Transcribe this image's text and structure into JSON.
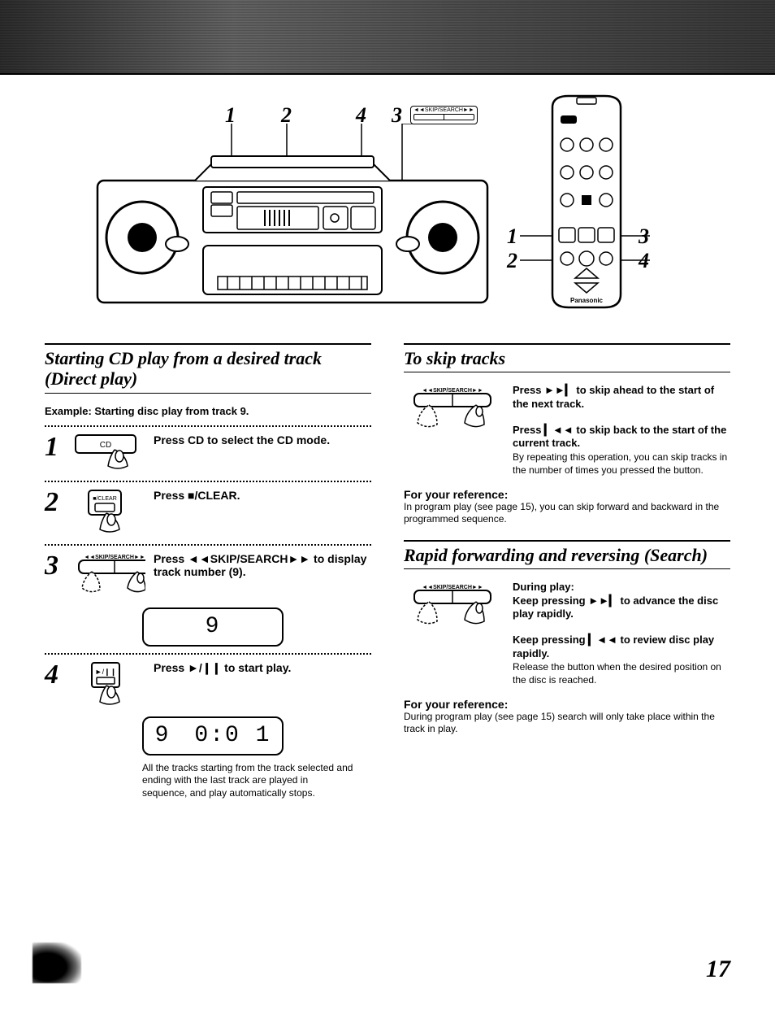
{
  "diagram": {
    "skip_search_label": "◄◄SKIP/SEARCH►►",
    "callouts_boombox": [
      "1",
      "2",
      "4",
      "3"
    ],
    "callouts_remote_left": [
      "1",
      "2"
    ],
    "callouts_remote_right": [
      "3",
      "4"
    ],
    "remote_brand": "Panasonic"
  },
  "left": {
    "title": "Starting CD play from a desired track (Direct play)",
    "example": "Example: Starting disc play from track 9.",
    "steps": [
      {
        "num": "1",
        "icon_label": "CD",
        "text_pre": "Press ",
        "text_b": "CD",
        "text_post": " to select the CD mode."
      },
      {
        "num": "2",
        "icon_label": "■/CLEAR",
        "text_pre": "Press ",
        "text_b": "■/CLEAR",
        "text_post": "."
      },
      {
        "num": "3",
        "icon_label": "◄◄SKIP/SEARCH►►",
        "text_pre": "Press ",
        "text_b": "◄◄SKIP/SEARCH►►",
        "text_post": " to display track number (9).",
        "lcd": {
          "track": "9"
        }
      },
      {
        "num": "4",
        "icon_label": "►/❙❙",
        "text_pre": "Press ",
        "text_b": "►/❙❙",
        "text_post": " to start play.",
        "lcd": {
          "track": "9",
          "time": "0:0 1"
        },
        "caption": "All the tracks starting from the track selected and ending with the last track are played in sequence, and play automatically stops."
      }
    ]
  },
  "right": {
    "skip": {
      "title": "To skip tracks",
      "icon_label": "◄◄SKIP/SEARCH►►",
      "fwd_pre": "Press ",
      "fwd_sym": "►►▎",
      "fwd_post": " to skip ahead to the start of the next track.",
      "back_pre": "Press ",
      "back_sym": "▎◄◄",
      "back_post": " to skip back to the start of the current track.",
      "back_detail": "By repeating this operation, you can skip tracks in the number of times you pressed the button.",
      "ref_head": "For your reference:",
      "ref_body": "In program play (see page 15), you can skip forward and backward in the programmed sequence."
    },
    "search": {
      "title": "Rapid forwarding and reversing (Search)",
      "icon_label": "◄◄SKIP/SEARCH►►",
      "during": "During play:",
      "fwd_pre": "Keep pressing ",
      "fwd_sym": "►►▎",
      "fwd_post": " to advance the disc play rapidly.",
      "back_pre": "Keep pressing ",
      "back_sym": "▎◄◄",
      "back_post": " to review disc play rapidly.",
      "back_detail": "Release the button when the desired position on the disc is reached.",
      "ref_head": "For your reference:",
      "ref_body": "During program play (see page 15) search will only take place within the track in play."
    }
  },
  "page_number": "17"
}
